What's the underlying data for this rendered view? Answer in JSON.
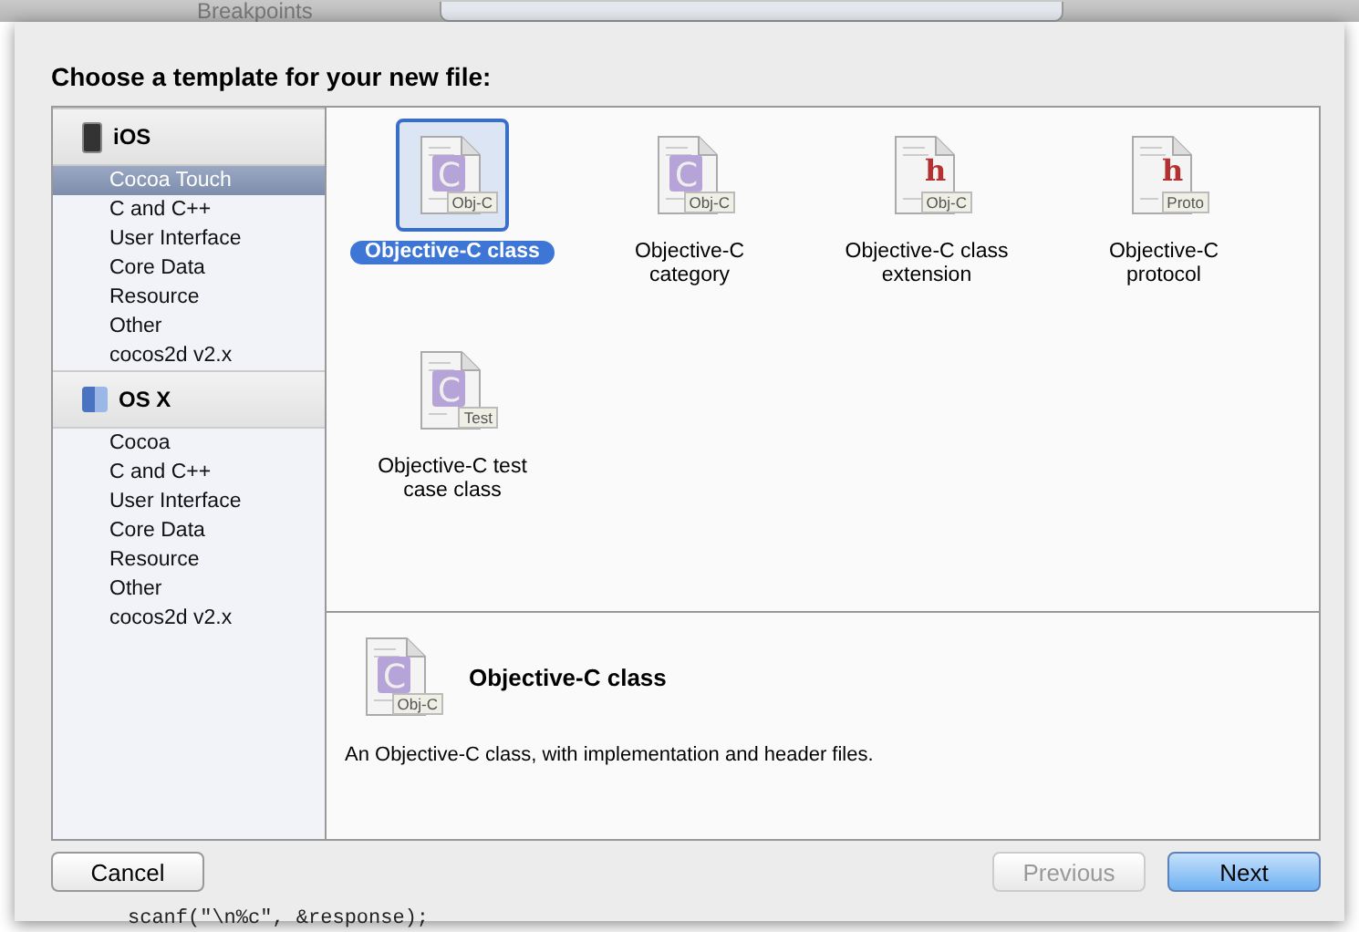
{
  "background_window": {
    "toolbar_label": "Breakpoints",
    "code_line": "scanf(\"\\n%c\", &response);"
  },
  "sheet": {
    "title": "Choose a template for your new file:",
    "sidebar": [
      {
        "kind": "ios",
        "label": "iOS",
        "items": [
          {
            "label": "Cocoa Touch",
            "selected": true
          },
          {
            "label": "C and C++",
            "selected": false
          },
          {
            "label": "User Interface",
            "selected": false
          },
          {
            "label": "Core Data",
            "selected": false
          },
          {
            "label": "Resource",
            "selected": false
          },
          {
            "label": "Other",
            "selected": false
          },
          {
            "label": "cocos2d v2.x",
            "selected": false
          }
        ]
      },
      {
        "kind": "osx",
        "label": "OS X",
        "items": [
          {
            "label": "Cocoa",
            "selected": false
          },
          {
            "label": "C and C++",
            "selected": false
          },
          {
            "label": "User Interface",
            "selected": false
          },
          {
            "label": "Core Data",
            "selected": false
          },
          {
            "label": "Resource",
            "selected": false
          },
          {
            "label": "Other",
            "selected": false
          },
          {
            "label": "cocos2d v2.x",
            "selected": false
          }
        ]
      }
    ],
    "templates": [
      {
        "label": "Objective-C class",
        "kind": "source",
        "letter": "C",
        "badge": "Obj-C",
        "selected": true
      },
      {
        "label": "Objective-C category",
        "kind": "source",
        "letter": "C",
        "badge": "Obj-C",
        "selected": false
      },
      {
        "label": "Objective-C class extension",
        "kind": "header",
        "letter": "h",
        "badge": "Obj-C",
        "selected": false
      },
      {
        "label": "Objective-C protocol",
        "kind": "header",
        "letter": "h",
        "badge": "Proto",
        "selected": false
      },
      {
        "label": "Objective-C test case class",
        "kind": "source",
        "letter": "C",
        "badge": "Test",
        "selected": false
      }
    ],
    "detail": {
      "kind": "source",
      "letter": "C",
      "badge": "Obj-C",
      "title": "Objective-C class",
      "description": "An Objective-C class, with implementation and header files."
    },
    "buttons": [
      {
        "label": "Cancel",
        "kind": "normal",
        "disabled": false
      },
      {
        "label": "Previous",
        "kind": "normal",
        "disabled": true
      },
      {
        "label": "Next",
        "kind": "default",
        "disabled": false
      }
    ]
  }
}
